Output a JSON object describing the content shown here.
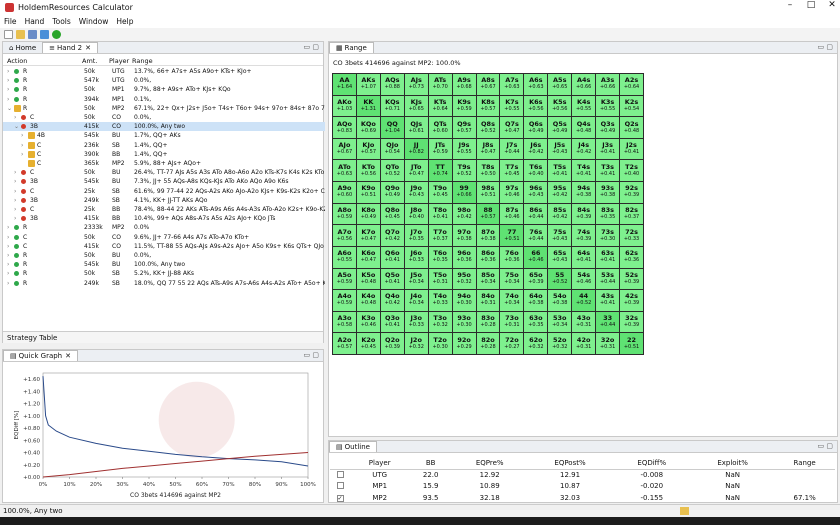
{
  "app": {
    "title": "HoldemResources Calculator"
  },
  "menu": [
    "File",
    "Hand",
    "Tools",
    "Window",
    "Help"
  ],
  "tabs": {
    "home": "Home",
    "hand": "Hand 2"
  },
  "actions": {
    "headers": {
      "action": "Action",
      "amt": "Amt.",
      "player": "Player",
      "range": "Range"
    },
    "rows": [
      {
        "lvl": 0,
        "exp": ">",
        "dot": "green",
        "act": "R",
        "amt": "50k",
        "pl": "UTG",
        "rng": "13.7%, 66+ A7s+ A5s A9o+ KTs+ KJo+"
      },
      {
        "lvl": 0,
        "exp": ">",
        "dot": "green",
        "act": "R",
        "amt": "547k",
        "pl": "UTG",
        "rng": "0.0%,"
      },
      {
        "lvl": 0,
        "exp": ">",
        "dot": "green",
        "act": "R",
        "amt": "50k",
        "pl": "MP1",
        "rng": "9.7%, 88+ A9s+ ATo+ KJs+ KQo"
      },
      {
        "lvl": 0,
        "exp": ">",
        "dot": "green",
        "act": "R",
        "amt": "394k",
        "pl": "MP1",
        "rng": "0.1%,"
      },
      {
        "lvl": 0,
        "exp": "v",
        "dot": "lock",
        "act": "R",
        "amt": "50k",
        "pl": "MP2",
        "rng": "67.1%, 22+ Qx+ J2s+ J5o+ T4s+ T6o+ 94s+ 97o+ 84s+ 87o 74s+"
      },
      {
        "lvl": 1,
        "exp": ">",
        "dot": "red",
        "act": "C",
        "amt": "50k",
        "pl": "CO",
        "rng": "0.0%,"
      },
      {
        "lvl": 1,
        "exp": "v",
        "dot": "red",
        "act": "3B",
        "amt": "415k",
        "pl": "CO",
        "rng": "100.0%, Any two",
        "sel": true
      },
      {
        "lvl": 2,
        "exp": ">",
        "dot": "lock",
        "act": "4B",
        "amt": "545k",
        "pl": "BU",
        "rng": "1.7%, QQ+ AKs"
      },
      {
        "lvl": 2,
        "exp": ">",
        "dot": "lock",
        "act": "C",
        "amt": "236k",
        "pl": "SB",
        "rng": "1.4%, QQ+"
      },
      {
        "lvl": 2,
        "exp": ">",
        "dot": "lock",
        "act": "C",
        "amt": "390k",
        "pl": "BB",
        "rng": "1.4%, QQ+"
      },
      {
        "lvl": 2,
        "exp": "",
        "dot": "lock",
        "act": "C",
        "amt": "365k",
        "pl": "MP2",
        "rng": "5.9%, 88+ AJs+ AQo+"
      },
      {
        "lvl": 1,
        "exp": ">",
        "dot": "red",
        "act": "C",
        "amt": "50k",
        "pl": "BU",
        "rng": "26.4%, TT-77 AJs A5s A3s ATo A8o-A6o A2o KTs-K7s K4s K2s KTo"
      },
      {
        "lvl": 1,
        "exp": ">",
        "dot": "red",
        "act": "3B",
        "amt": "545k",
        "pl": "BU",
        "rng": "7.3%, JJ+ 55 AQs-A8s KQs-KJs ATo AKo AQo A9o K6s"
      },
      {
        "lvl": 1,
        "exp": ">",
        "dot": "red",
        "act": "C",
        "amt": "25k",
        "pl": "SB",
        "rng": "61.6%, 99 77-44 22 AQs-A2s AKo AJo-A2o KJs+ K9s-K2s K2o+ C"
      },
      {
        "lvl": 1,
        "exp": ">",
        "dot": "red",
        "act": "3B",
        "amt": "249k",
        "pl": "SB",
        "rng": "4.1%, KK+ JJ-TT AKs AQo"
      },
      {
        "lvl": 1,
        "exp": ">",
        "dot": "red",
        "act": "C",
        "amt": "25k",
        "pl": "BB",
        "rng": "78.4%, 88-44 22 AKs ATs-A9s A6s A4s-A3s ATo-A2o K2s+ K9o-K2"
      },
      {
        "lvl": 1,
        "exp": ">",
        "dot": "red",
        "act": "3B",
        "amt": "415k",
        "pl": "BB",
        "rng": "10.4%, 99+ AQs A8s-A7s A5s A2s AJo+ KQo JTs"
      },
      {
        "lvl": 0,
        "exp": ">",
        "dot": "green",
        "act": "R",
        "amt": "2333k",
        "pl": "MP2",
        "rng": "0.0%"
      },
      {
        "lvl": 0,
        "exp": ">",
        "dot": "green",
        "act": "C",
        "amt": "50k",
        "pl": "CO",
        "rng": "9.6%, JJ+ 77-66 A4s A7s ATo-A7o KTo+"
      },
      {
        "lvl": 0,
        "exp": ">",
        "dot": "green",
        "act": "C",
        "amt": "415k",
        "pl": "CO",
        "rng": "11.5%, TT-88 55 AQs-AJs A9s-A2s AJo+ A5o K9s+ K6s QTs+ QJo"
      },
      {
        "lvl": 0,
        "exp": ">",
        "dot": "green",
        "act": "R",
        "amt": "50k",
        "pl": "BU",
        "rng": "0.0%,"
      },
      {
        "lvl": 0,
        "exp": ">",
        "dot": "green",
        "act": "R",
        "amt": "545k",
        "pl": "BU",
        "rng": "100.0%, Any two"
      },
      {
        "lvl": 0,
        "exp": ">",
        "dot": "green",
        "act": "R",
        "amt": "50k",
        "pl": "SB",
        "rng": "5.2%, KK+ JJ-88 AKs"
      },
      {
        "lvl": 0,
        "exp": ">",
        "dot": "green",
        "act": "R",
        "amt": "249k",
        "pl": "SB",
        "rng": "18.0%, QQ 77 55 22 AQs ATs-A9s A7s-A6s A4s-A2s ATo+ A5o+ K9s+"
      }
    ]
  },
  "strategy_table": "Strategy Table",
  "quick_graph": {
    "title": "Quick Graph",
    "ylabel": "EQDiff [%]",
    "xlabel": "CO 3bets 414696 against MP2",
    "yticks": [
      "+1.60",
      "+1.40",
      "+1.20",
      "+1.00",
      "+0.80",
      "+0.60",
      "+0.40",
      "+0.20",
      "+0.00"
    ],
    "xticks": [
      "0%",
      "10%",
      "20%",
      "30%",
      "40%",
      "50%",
      "60%",
      "70%",
      "80%",
      "90%",
      "100%"
    ]
  },
  "chart_data": {
    "type": "line",
    "xlabel": "CO 3bets 414696 against MP2",
    "ylabel": "EQDiff [%]",
    "ylim": [
      0,
      1.7
    ],
    "xlim": [
      0,
      100
    ],
    "series": [
      {
        "color": "#2a4a8a",
        "x": [
          0,
          1,
          2,
          5,
          10,
          20,
          30,
          40,
          50,
          60,
          70,
          80,
          90,
          100
        ],
        "y": [
          1.65,
          1.0,
          0.85,
          0.75,
          0.65,
          0.55,
          0.47,
          0.42,
          0.37,
          0.33,
          0.3,
          0.28,
          0.25,
          0.18
        ]
      },
      {
        "color": "#a03030",
        "x": [
          0,
          10,
          20,
          30,
          40,
          50,
          60,
          70,
          80,
          90,
          100
        ],
        "y": [
          0.0,
          0.04,
          0.09,
          0.14,
          0.18,
          0.22,
          0.26,
          0.3,
          0.34,
          0.37,
          0.4
        ]
      }
    ]
  },
  "range": {
    "title": "Range",
    "subtitle": "CO 3bets 414696 against MP2: 100.0%"
  },
  "grid": [
    [
      "AA|+1.64",
      "AKs|+1.07",
      "AQs|+0.88",
      "AJs|+0.73",
      "ATs|+0.70",
      "A9s|+0.68",
      "A8s|+0.67",
      "A7s|+0.63",
      "A6s|+0.63",
      "A5s|+0.65",
      "A4s|+0.66",
      "A3s|+0.66",
      "A2s|+0.64"
    ],
    [
      "AKo|+1.03",
      "KK|+1.31",
      "KQs|+0.71",
      "KJs|+0.65",
      "KTs|+0.64",
      "K9s|+0.59",
      "K8s|+0.57",
      "K7s|+0.55",
      "K6s|+0.56",
      "K5s|+0.56",
      "K4s|+0.55",
      "K3s|+0.55",
      "K2s|+0.54"
    ],
    [
      "AQo|+0.83",
      "KQo|+0.69",
      "QQ|+1.04",
      "QJs|+0.61",
      "QTs|+0.60",
      "Q9s|+0.57",
      "Q8s|+0.52",
      "Q7s|+0.47",
      "Q6s|+0.49",
      "Q5s|+0.49",
      "Q4s|+0.48",
      "Q3s|+0.49",
      "Q2s|+0.48"
    ],
    [
      "AJo|+0.67",
      "KJo|+0.57",
      "QJo|+0.54",
      "JJ|+0.82",
      "JTs|+0.59",
      "J9s|+0.55",
      "J8s|+0.47",
      "J7s|+0.44",
      "J6s|+0.42",
      "J5s|+0.43",
      "J4s|+0.42",
      "J3s|+0.41",
      "J2s|+0.41"
    ],
    [
      "ATo|+0.63",
      "KTo|+0.56",
      "QTo|+0.52",
      "JTo|+0.47",
      "TT|+0.74",
      "T9s|+0.52",
      "T8s|+0.50",
      "T7s|+0.45",
      "T6s|+0.40",
      "T5s|+0.41",
      "T4s|+0.41",
      "T3s|+0.41",
      "T2s|+0.40"
    ],
    [
      "A9o|+0.60",
      "K9o|+0.51",
      "Q9o|+0.49",
      "J9o|+0.43",
      "T9o|+0.45",
      "99|+0.66",
      "98s|+0.51",
      "97s|+0.46",
      "96s|+0.43",
      "95s|+0.42",
      "94s|+0.38",
      "93s|+0.38",
      "92s|+0.39"
    ],
    [
      "A8o|+0.59",
      "K8o|+0.49",
      "Q8o|+0.45",
      "J8o|+0.40",
      "T8o|+0.41",
      "98o|+0.42",
      "88|+0.57",
      "87s|+0.46",
      "86s|+0.44",
      "85s|+0.42",
      "84s|+0.39",
      "83s|+0.35",
      "82s|+0.37"
    ],
    [
      "A7o|+0.56",
      "K7o|+0.47",
      "Q7o|+0.42",
      "J7o|+0.35",
      "T7o|+0.37",
      "97o|+0.38",
      "87o|+0.38",
      "77|+0.51",
      "76s|+0.44",
      "75s|+0.43",
      "74s|+0.39",
      "73s|+0.30",
      "72s|+0.33"
    ],
    [
      "A6o|+0.55",
      "K6o|+0.47",
      "Q6o|+0.41",
      "J6o|+0.33",
      "T6o|+0.35",
      "96o|+0.36",
      "86o|+0.36",
      "76o|+0.36",
      "66|+0.46",
      "65s|+0.43",
      "64s|+0.41",
      "63s|+0.41",
      "62s|+0.36"
    ],
    [
      "A5o|+0.59",
      "K5o|+0.48",
      "Q5o|+0.41",
      "J5o|+0.34",
      "T5o|+0.31",
      "95o|+0.32",
      "85o|+0.34",
      "75o|+0.34",
      "65o|+0.39",
      "55|+0.52",
      "54s|+0.46",
      "53s|+0.44",
      "52s|+0.39"
    ],
    [
      "A4o|+0.59",
      "K4o|+0.48",
      "Q4o|+0.42",
      "J4o|+0.34",
      "T4o|+0.33",
      "94o|+0.30",
      "84o|+0.31",
      "74o|+0.34",
      "64o|+0.38",
      "54o|+0.38",
      "44|+0.52",
      "43s|+0.41",
      "42s|+0.39"
    ],
    [
      "A3o|+0.58",
      "K3o|+0.46",
      "Q3o|+0.41",
      "J3o|+0.33",
      "T3o|+0.32",
      "93o|+0.30",
      "83o|+0.28",
      "73o|+0.31",
      "63o|+0.35",
      "53o|+0.34",
      "43o|+0.31",
      "33|+0.44",
      "32s|+0.39"
    ],
    [
      "A2o|+0.57",
      "K2o|+0.45",
      "Q2o|+0.39",
      "J2o|+0.32",
      "T2o|+0.30",
      "92o|+0.29",
      "82o|+0.28",
      "72o|+0.27",
      "62o|+0.32",
      "52o|+0.32",
      "42o|+0.31",
      "32o|+0.31",
      "22|+0.51"
    ]
  ],
  "outline": {
    "title": "Outline",
    "headers": [
      "Player",
      "BB",
      "EQPre%",
      "EQPost%",
      "EQDiff%",
      "Exploit%",
      "Range"
    ],
    "rows": [
      {
        "checked": false,
        "player": "UTG",
        "bb": "22.0",
        "pre": "12.92",
        "post": "12.91",
        "diff": "-0.008",
        "exploit": "NaN",
        "range": ""
      },
      {
        "checked": false,
        "player": "MP1",
        "bb": "15.9",
        "pre": "10.89",
        "post": "10.87",
        "diff": "-0.020",
        "exploit": "NaN",
        "range": ""
      },
      {
        "checked": true,
        "player": "MP2",
        "bb": "93.5",
        "pre": "32.18",
        "post": "32.03",
        "diff": "-0.155",
        "exploit": "NaN",
        "range": "67.1%"
      }
    ]
  },
  "status": "100.0%, Any two"
}
